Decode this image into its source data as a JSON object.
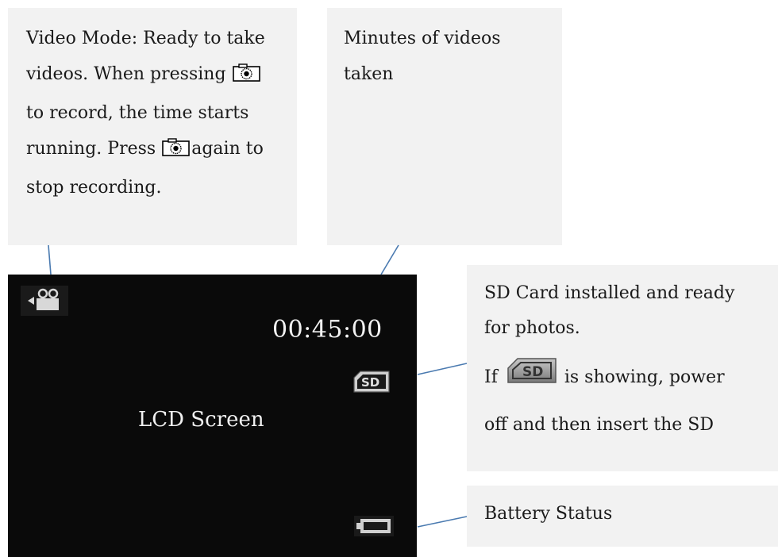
{
  "callout_video_mode": {
    "line1": "Video Mode: Ready to take",
    "line2_pre": "videos. When pressing",
    "line3": "to record, the time starts",
    "line4_pre": "running. Press",
    "line4_post": "again to",
    "line5": "stop recording.",
    "icon": "camera-shutter-icon"
  },
  "callout_minutes": {
    "line1": "Minutes of videos",
    "line2": "taken"
  },
  "callout_sd": {
    "line1": "SD Card installed and ready",
    "line2": "for photos.",
    "line3_pre": "If",
    "line3_post": "is showing, power",
    "line4": "off and then insert the SD",
    "icon": "sd-card-missing-icon"
  },
  "callout_battery": {
    "text": "Battery Status"
  },
  "lcd": {
    "time": "00:45:00",
    "label": "LCD Screen",
    "mode_icon": "video-camera-icon",
    "sd_icon": "sd-card-icon",
    "battery_icon": "battery-icon",
    "sd_text": "SD"
  }
}
